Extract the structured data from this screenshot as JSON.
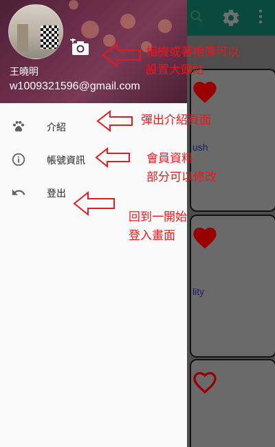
{
  "drawer": {
    "user_name": "王曉明",
    "user_email": "w1009321596@gmail.com",
    "menu": [
      {
        "label": "介紹",
        "icon": "paw-icon"
      },
      {
        "label": "帳號資訊",
        "icon": "info-icon"
      },
      {
        "label": "登出",
        "icon": "undo-icon"
      }
    ]
  },
  "background": {
    "cards": [
      {
        "text": "ush"
      },
      {
        "text": "lity"
      },
      {
        "text": ""
      }
    ]
  },
  "annotations": {
    "camera_note_line1": "相機或著相簿可以",
    "camera_note_line2": "設置大頭貼",
    "intro_note": "彈出介紹頁面",
    "account_note_line1": "會員資料",
    "account_note_line2": "部分可以修改",
    "logout_note_line1": "回到一開始",
    "logout_note_line2": "登入畫面"
  },
  "colors": {
    "annotation": "#e8191c",
    "app_bar": "#0a4a3e",
    "header_gradient_mid": "#6a2c4a",
    "heart": "#b00000"
  }
}
